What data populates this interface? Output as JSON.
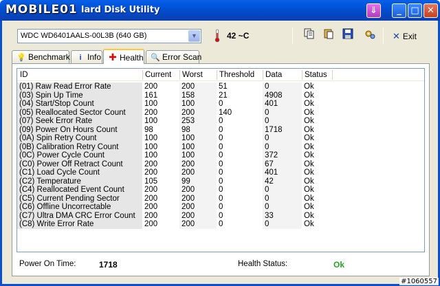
{
  "window": {
    "logo": "MOBILE01",
    "title": "lard Disk Utility"
  },
  "toolbar": {
    "drive": "WDC WD6401AALS-00L3B (640 GB)",
    "temperature": "42 ~C",
    "exit_label": "Exit"
  },
  "tabs": [
    {
      "label": "Benchmark",
      "icon": "lightbulb-icon"
    },
    {
      "label": "Info",
      "icon": "info-icon"
    },
    {
      "label": "Health",
      "icon": "cross-icon"
    },
    {
      "label": "Error Scan",
      "icon": "search-icon"
    }
  ],
  "table": {
    "columns": [
      "ID",
      "Current",
      "Worst",
      "Threshold",
      "Data",
      "Status"
    ],
    "rows": [
      [
        "(01) Raw Read Error Rate",
        "200",
        "200",
        "51",
        "0",
        "Ok"
      ],
      [
        "(03) Spin Up Time",
        "161",
        "158",
        "21",
        "4908",
        "Ok"
      ],
      [
        "(04) Start/Stop Count",
        "100",
        "100",
        "0",
        "401",
        "Ok"
      ],
      [
        "(05) Reallocated Sector Count",
        "200",
        "200",
        "140",
        "0",
        "Ok"
      ],
      [
        "(07) Seek Error Rate",
        "100",
        "253",
        "0",
        "0",
        "Ok"
      ],
      [
        "(09) Power On Hours Count",
        "98",
        "98",
        "0",
        "1718",
        "Ok"
      ],
      [
        "(0A) Spin Retry Count",
        "100",
        "100",
        "0",
        "0",
        "Ok"
      ],
      [
        "(0B) Calibration Retry Count",
        "100",
        "100",
        "0",
        "0",
        "Ok"
      ],
      [
        "(0C) Power Cycle Count",
        "100",
        "100",
        "0",
        "372",
        "Ok"
      ],
      [
        "(C0) Power Off Retract Count",
        "200",
        "200",
        "0",
        "67",
        "Ok"
      ],
      [
        "(C1) Load Cycle Count",
        "200",
        "200",
        "0",
        "401",
        "Ok"
      ],
      [
        "(C2) Temperature",
        "105",
        "99",
        "0",
        "42",
        "Ok"
      ],
      [
        "(C4) Reallocated Event Count",
        "200",
        "200",
        "0",
        "0",
        "Ok"
      ],
      [
        "(C5) Current Pending Sector",
        "200",
        "200",
        "0",
        "0",
        "Ok"
      ],
      [
        "(C6) Offline Uncorrectable",
        "200",
        "200",
        "0",
        "0",
        "Ok"
      ],
      [
        "(C7) Ultra DMA CRC Error Count",
        "200",
        "200",
        "0",
        "33",
        "Ok"
      ],
      [
        "(C8) Write Error Rate",
        "200",
        "200",
        "0",
        "0",
        "Ok"
      ]
    ]
  },
  "footer": {
    "power_on_label": "Power On Time:",
    "power_on_value": "1718",
    "health_label": "Health Status:",
    "health_value": "Ok",
    "health_color": "#2aa02a"
  },
  "watermark": "#1060557"
}
